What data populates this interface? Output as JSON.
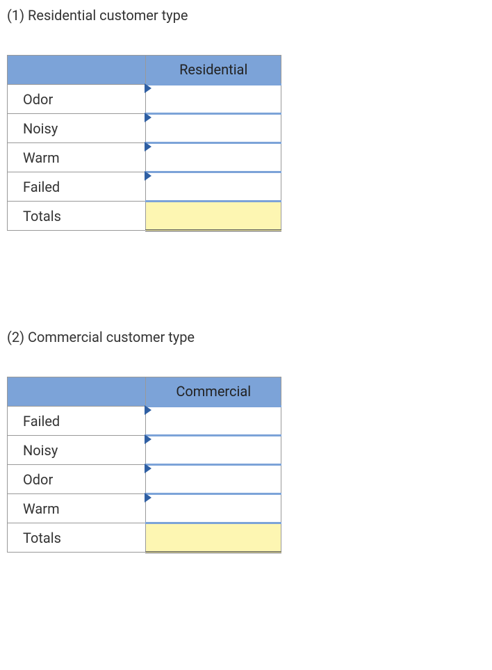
{
  "sections": [
    {
      "title": "(1) Residential customer type",
      "column_header": "Residential",
      "rows": [
        {
          "label": "Odor",
          "value": ""
        },
        {
          "label": "Noisy",
          "value": ""
        },
        {
          "label": "Warm",
          "value": ""
        },
        {
          "label": "Failed",
          "value": ""
        }
      ],
      "totals_label": "Totals",
      "totals_value": ""
    },
    {
      "title": "(2) Commercial customer type",
      "column_header": "Commercial",
      "rows": [
        {
          "label": "Failed",
          "value": ""
        },
        {
          "label": "Noisy",
          "value": ""
        },
        {
          "label": "Odor",
          "value": ""
        },
        {
          "label": "Warm",
          "value": ""
        }
      ],
      "totals_label": "Totals",
      "totals_value": ""
    }
  ]
}
